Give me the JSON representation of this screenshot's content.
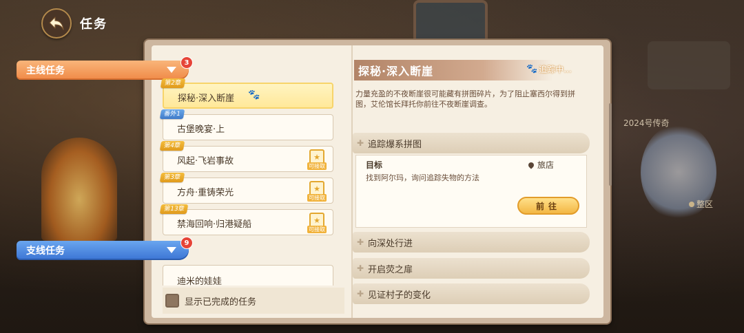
{
  "header": {
    "title": "任务"
  },
  "background": {
    "sign_year": "2024号传奇",
    "sign_area": "整区"
  },
  "main_category": {
    "label": "主线任务",
    "count": "3"
  },
  "main_quests": [
    {
      "chapter": "第2章",
      "title": "探秘·深入断崖"
    },
    {
      "chapter": "番外1",
      "title": "古堡晚宴·上"
    },
    {
      "chapter": "第4章",
      "title": "风起·飞岩事故",
      "badge": "可接取"
    },
    {
      "chapter": "第3章",
      "title": "方舟·重铸荣光",
      "badge": "可接取"
    },
    {
      "chapter": "第13章",
      "title": "禁海回响·归港疑船",
      "badge": "可接取"
    }
  ],
  "side_category": {
    "label": "支线任务",
    "count": "9"
  },
  "side_quests": [
    {
      "title": "迪米的娃娃"
    }
  ],
  "show_completed": {
    "label": "显示已完成的任务"
  },
  "detail": {
    "title": "探秘·深入断崖",
    "tracking": "追踪中...",
    "description": "力量充盈的不夜断崖很可能藏有拼图碎片，为了阻止塞西尔得到拼图，艾伦馆长拜托你前往不夜断崖调查。",
    "tasks": [
      "追踪爆系拼图",
      "向深处行进",
      "开启荧之扉",
      "见证村子的变化"
    ],
    "goal_label": "目标",
    "goal_location": "旅店",
    "goal_desc": "找到阿尔玛，询问追踪失物的方法",
    "goto_label": "前往"
  }
}
